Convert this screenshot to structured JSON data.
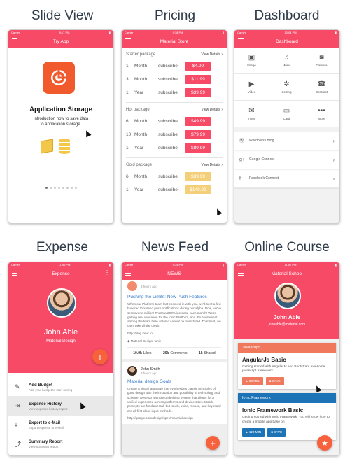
{
  "titles": [
    "Slide View",
    "Pricing",
    "Dashboard",
    "Expense",
    "News Feed",
    "Online Course"
  ],
  "colors": {
    "primary": "#f74a67",
    "fab": "#f7613b",
    "price_red": "#f74a67",
    "price_gold": "#f4cf7a",
    "link_blue": "#3a7dc9",
    "course_js": "#f0785c",
    "course_ionic": "#1c73b5"
  },
  "status": {
    "carrier": "Carrier",
    "time1": "9:17 PM",
    "time2": "9:18 PM",
    "time3": "10:04 PM",
    "time4": "11:56 PM",
    "time5": "5:34 PM",
    "time6": "11:57 PM"
  },
  "slide": {
    "nav_title": "Try App",
    "app_icon": "target-icon",
    "heading": "Application Storage",
    "text_line1": "Introduction how to save data",
    "text_line2": "to application storage.",
    "dots": 8
  },
  "pricing": {
    "nav_title": "Material Store",
    "packages": [
      {
        "name": "Starter package",
        "link": "View Details",
        "color": "#f74a67",
        "rows": [
          {
            "qty": "1",
            "unit": "Month",
            "label": "subscribe",
            "price": "$4.99"
          },
          {
            "qty": "3",
            "unit": "Month",
            "label": "subscribe",
            "price": "$11.99"
          },
          {
            "qty": "1",
            "unit": "Year",
            "label": "subscribe",
            "price": "$39.99"
          }
        ]
      },
      {
        "name": "Hot package",
        "link": "View Details",
        "color": "#f74a67",
        "rows": [
          {
            "qty": "6",
            "unit": "Month",
            "label": "subscribe",
            "price": "$49.99"
          },
          {
            "qty": "10",
            "unit": "Month",
            "label": "subscribe",
            "price": "$79.99"
          },
          {
            "qty": "1",
            "unit": "Year",
            "label": "subscribe",
            "price": "$89.99"
          }
        ]
      },
      {
        "name": "Gold package",
        "link": "View Details",
        "color": "#f4cf7a",
        "rows": [
          {
            "qty": "6",
            "unit": "Month",
            "label": "subscribe",
            "price": "$39.99"
          },
          {
            "qty": "1",
            "unit": "Year",
            "label": "subscribe",
            "price": "$149.99"
          }
        ]
      }
    ]
  },
  "dashboard": {
    "nav_title": "Dashboard",
    "tiles": [
      {
        "label": "Image",
        "icon": "image-icon",
        "glyph": "▣"
      },
      {
        "label": "Music",
        "icon": "music-icon",
        "glyph": "♫"
      },
      {
        "label": "Camera",
        "icon": "camera-icon",
        "glyph": "◙"
      },
      {
        "label": "Video",
        "icon": "video-icon",
        "glyph": "▶"
      },
      {
        "label": "Setting",
        "icon": "gear-icon",
        "glyph": "✲"
      },
      {
        "label": "Contract",
        "icon": "contract-icon",
        "glyph": "☎"
      },
      {
        "label": "Inbox",
        "icon": "inbox-icon",
        "glyph": "✉"
      },
      {
        "label": "Card",
        "icon": "card-icon",
        "glyph": "▭"
      },
      {
        "label": "More",
        "icon": "more-icon",
        "glyph": "•••"
      }
    ],
    "list": [
      {
        "label": "Wordpress Blog",
        "icon": "wordpress-icon",
        "glyph": "Ⓦ"
      },
      {
        "label": "Google Connect",
        "icon": "google-plus-icon",
        "glyph": "g+"
      },
      {
        "label": "Facebook Connect",
        "icon": "facebook-icon",
        "glyph": "f"
      }
    ]
  },
  "expense": {
    "nav_title": "Expense",
    "name": "John Able",
    "subtitle": "Material Design",
    "items": [
      {
        "title": "Add Budget",
        "sub": "Add your budget to start saving",
        "icon": "edit-icon",
        "glyph": "✎"
      },
      {
        "title": "Expense History",
        "sub": "View expense history report",
        "icon": "login-icon",
        "glyph": "⇥"
      },
      {
        "title": "Export to e-Mail",
        "sub": "Export expense to e-Mail",
        "icon": "export-icon",
        "glyph": "⤓"
      },
      {
        "title": "Summary Report",
        "sub": "View summary report",
        "icon": "chart-icon",
        "glyph": "⤴"
      }
    ]
  },
  "news": {
    "nav_title": "NEWS",
    "top_time": "3 hours ago",
    "post1_title": "Pushing the Limits: New Push Features",
    "post1_body": "When our Platform team last checked in with you, we'd sent a few hundred thousand push notifications during our alpha. Now, we've sent over a million! That's a 200% increase each month! We're getting real validation for the Ionic Platform, and the excitement among the team here at Ionic cannot be overstated. That said, we can't take all the credit.",
    "post1_link": "http://blog.ionic.io/",
    "post1_tags": "Material Design, Ionic",
    "stats": [
      {
        "v": "10.9k",
        "l": "Likes"
      },
      {
        "v": "20k",
        "l": "Comments"
      },
      {
        "v": "1k",
        "l": "Shared"
      }
    ],
    "author_name": "John Smith",
    "author_time": "3 hours ago",
    "post2_title": "Material design Goals",
    "post2_body": "Create a visual language that synthesizes classic principles of good design with the innovation and possibility of technology and science. Develop a single underlying system that allows for a unified experience across platforms and device sizes. Mobile precepts are fundamental, but touch, voice, mouse, and keyboard are all first-class input methods.",
    "post2_link": "http://google.com/design/spec/material-design"
  },
  "course": {
    "nav_title": "Material School",
    "name": "John Able",
    "email": "johnable@material.com",
    "courses": [
      {
        "tag": "Javascript",
        "title": "AngularJs Basic",
        "desc": "Getting started with AngularJs and Bootstrap. Awesome javascript framework",
        "duration": "90 MIN",
        "save": "SAVE",
        "color": "#f0785c"
      },
      {
        "tag": "Ionic Framework",
        "title": "Ionic Framework Basic",
        "desc": "Getting started with Ionic Framework. You will know how to create a mobile app base on",
        "duration": "120 MIN",
        "save": "SAVE",
        "color": "#1c73b5"
      }
    ]
  }
}
